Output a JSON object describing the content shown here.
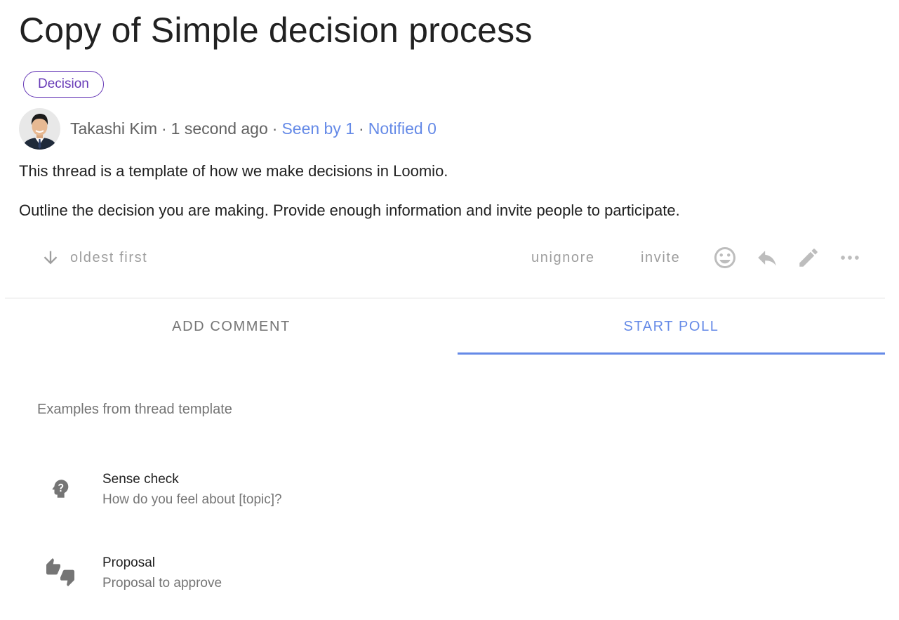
{
  "thread": {
    "title": "Copy of Simple decision process",
    "tag": "Decision",
    "author": "Takashi Kim",
    "time": "1 second ago",
    "seen": "Seen by 1",
    "notified": "Notified 0",
    "separator": "·",
    "paragraphs": [
      "This thread is a template of how we make decisions in Loomio.",
      "Outline the decision you are making. Provide enough information and invite people to participate."
    ]
  },
  "actions": {
    "sort_label": "oldest first",
    "unignore": "unignore",
    "invite": "invite",
    "icons": [
      "arrow-down-icon",
      "emoji-icon",
      "reply-icon",
      "edit-icon",
      "more-icon"
    ]
  },
  "tabs": [
    {
      "label": "ADD COMMENT",
      "active": false
    },
    {
      "label": "START POLL",
      "active": true
    }
  ],
  "poll_templates": {
    "header": "Examples from thread template",
    "items": [
      {
        "title": "Sense check",
        "subtitle": "How do you feel about [topic]?",
        "icon": "head-question-icon"
      },
      {
        "title": "Proposal",
        "subtitle": "Proposal to approve",
        "icon": "thumbs-up-down-icon"
      }
    ]
  },
  "colors": {
    "accent": "#658ae7",
    "tag": "#673ab7",
    "muted": "#9e9e9e"
  }
}
